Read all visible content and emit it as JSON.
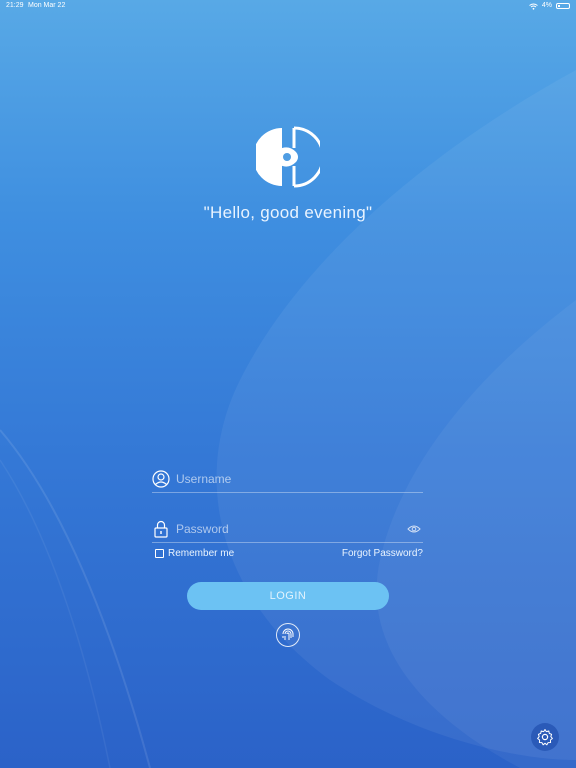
{
  "status_bar": {
    "time": "21:29",
    "date": "Mon Mar 22",
    "battery": "4%",
    "wifi_icon": "wifi-icon",
    "battery_icon": "battery-icon"
  },
  "brand": {
    "logo_icon": "app-logo-icon"
  },
  "greeting": "\"Hello, good evening\"",
  "form": {
    "username_placeholder": "Username",
    "password_placeholder": "Password",
    "remember_label": "Remember me",
    "remember_checked": false,
    "forgot_label": "Forgot Password?",
    "login_label": "LOGIN"
  },
  "icons": {
    "user": "user-icon",
    "lock": "lock-icon",
    "eye": "eye-icon",
    "fingerprint": "fingerprint-icon",
    "settings": "gear-icon"
  },
  "colors": {
    "accent": "#6cc2f3",
    "bg_top": "#58a9e6",
    "bg_bottom": "#2b62c8"
  }
}
